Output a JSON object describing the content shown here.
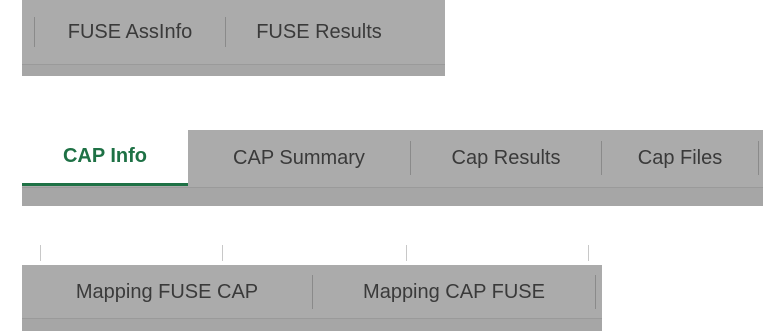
{
  "strip1": {
    "tabs": [
      "FUSE AssInfo",
      "FUSE Results"
    ]
  },
  "strip2": {
    "tabs": [
      "CAP Info",
      "CAP Summary",
      "Cap Results",
      "Cap Files"
    ],
    "active_tab": "CAP Info"
  },
  "strip3": {
    "tabs": [
      "Mapping FUSE CAP",
      "Mapping CAP FUSE"
    ]
  },
  "colors": {
    "tab_bar": "#ababab",
    "active_tab_text": "#1e7145",
    "active_tab_background": "#ffffff"
  }
}
